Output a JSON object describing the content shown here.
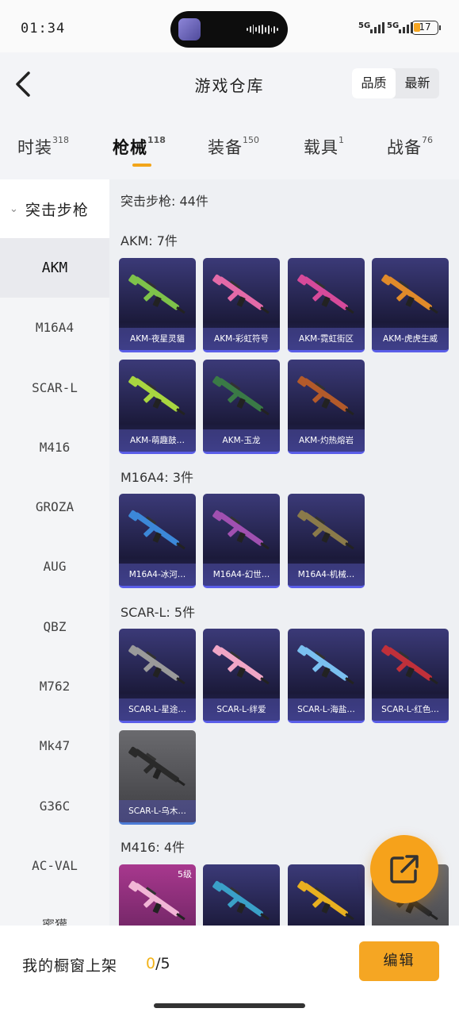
{
  "status_bar": {
    "time": "01:34",
    "signal_1": "5G",
    "signal_2": "5G",
    "battery": "17"
  },
  "header": {
    "title": "游戏仓库",
    "sort_options": [
      "品质",
      "最新"
    ]
  },
  "tabs": [
    {
      "label": "时装",
      "count": "318"
    },
    {
      "label": "枪械",
      "count": "118"
    },
    {
      "label": "装备",
      "count": "150"
    },
    {
      "label": "载具",
      "count": "1"
    },
    {
      "label": "战备",
      "count": "76"
    }
  ],
  "sidebar": {
    "category": "突击步枪",
    "items": [
      "AKM",
      "M16A4",
      "SCAR-L",
      "M416",
      "GROZA",
      "AUG",
      "QBZ",
      "M762",
      "Mk47",
      "G36C",
      "AC-VAL",
      "蜜獾"
    ]
  },
  "content": {
    "summary": "突击步枪: 44件",
    "groups": [
      {
        "title": "AKM: 7件",
        "items": [
          "AKM-夜星灵貓",
          "AKM-彩虹符号",
          "AKM-霓虹街区",
          "AKM-虎虎生威",
          "AKM-萌趣鼓…",
          "AKM-玉龙",
          "AKM-灼热熔岩"
        ]
      },
      {
        "title": "M16A4: 3件",
        "items": [
          "M16A4-冰河…",
          "M16A4-幻世…",
          "M16A4-机械…"
        ]
      },
      {
        "title": "SCAR-L: 5件",
        "items": [
          "SCAR-L-星途…",
          "SCAR-L-绊爱",
          "SCAR-L-海盐…",
          "SCAR-L-红色…",
          "SCAR-L-乌木…"
        ]
      },
      {
        "title": "M416: 4件",
        "grade_badge": "5级"
      }
    ]
  },
  "bottom_bar": {
    "label": "我的橱窗上架",
    "current": "0",
    "total": "/5",
    "edit_label": "编辑"
  },
  "colors": {
    "accent": "#f5a623",
    "card_bg": "#2a2960",
    "card_label_bg": "#5050aa"
  }
}
